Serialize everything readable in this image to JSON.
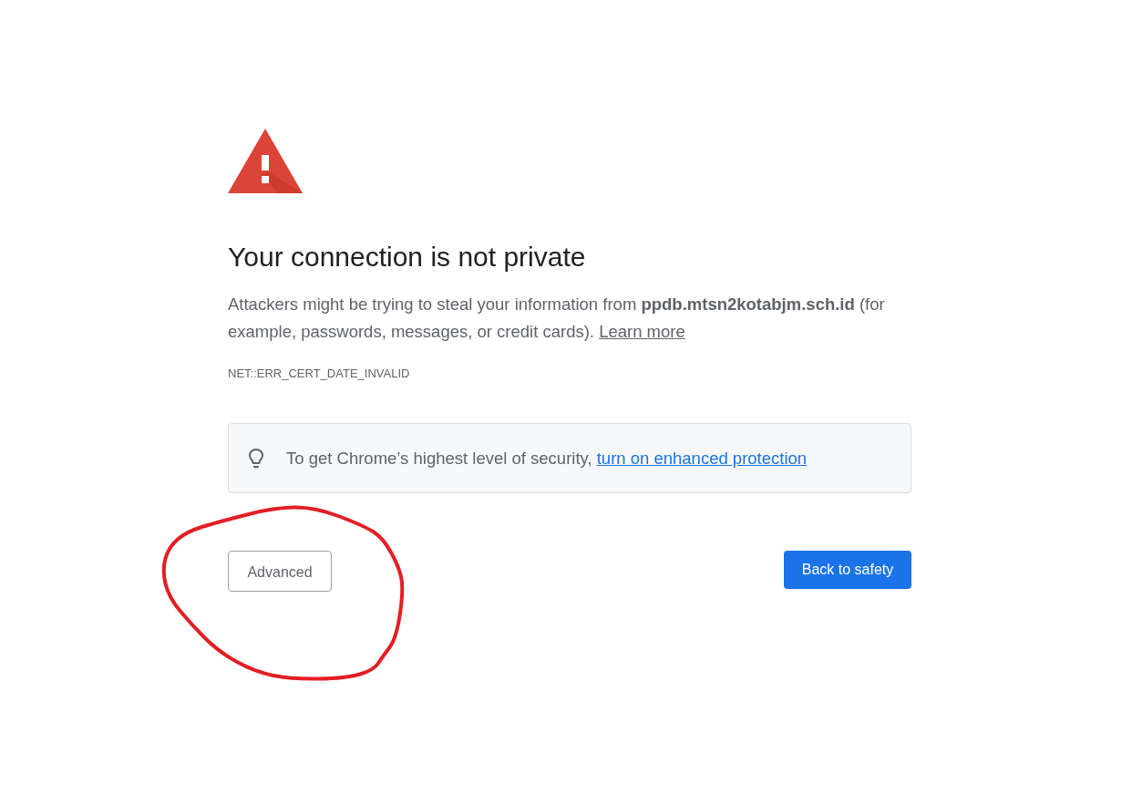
{
  "heading": "Your connection is not private",
  "message": {
    "text": "Attackers might be trying to steal your information from **ppdb.mtsn2kotabjm.sch.id** (for example, passwords, messages, or credit cards).",
    "link": "Learn more"
  },
  "error_code": "NET::ERR_CERT_DATE_INVALID",
  "enhanced_protection_tip": {
    "text": "To get Chrome’s highest level of security,",
    "link": "turn on enhanced protection"
  },
  "buttons": [
    {
      "label": "Advanced",
      "kind": "secondary"
    },
    {
      "label": "Back to safety",
      "kind": "primary"
    }
  ],
  "annotation": {
    "kind": "freehand-circle"
  }
}
